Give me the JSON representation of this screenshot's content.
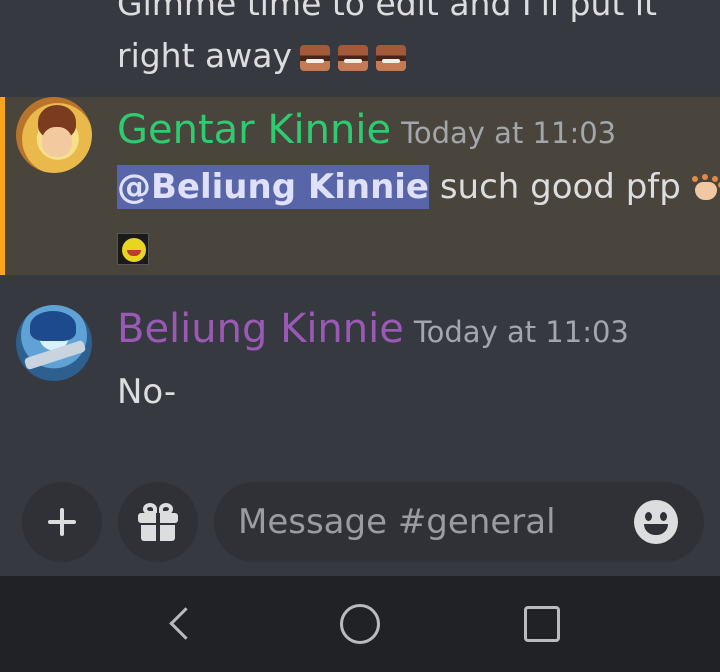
{
  "previous_message": {
    "line1": "Gimme time to edit and I'll put it",
    "line2": "right away",
    "emojis": [
      "laughing-face-emoji",
      "laughing-face-emoji",
      "laughing-face-emoji"
    ]
  },
  "messages": [
    {
      "username": "Gentar Kinnie",
      "timestamp": "Today at 11:03",
      "mention": "@Beliung Kinnie",
      "text": "such good pfp",
      "highlighted": true,
      "username_color": "#2ecc71"
    },
    {
      "username": "Beliung Kinnie",
      "timestamp": "Today at 11:03",
      "text": "No-",
      "highlighted": false,
      "username_color": "#9b59b6"
    }
  ],
  "composer": {
    "placeholder": "Message #general",
    "icons": [
      "plus-icon",
      "gift-icon",
      "emoji-smile-icon"
    ]
  },
  "nav": {
    "icons": [
      "back-icon",
      "home-icon",
      "recents-icon"
    ]
  },
  "colors": {
    "background": "#36393f",
    "mention_highlight": "#49443c",
    "mention_bar": "#faa61a",
    "mention_tag": "#5865a8"
  }
}
